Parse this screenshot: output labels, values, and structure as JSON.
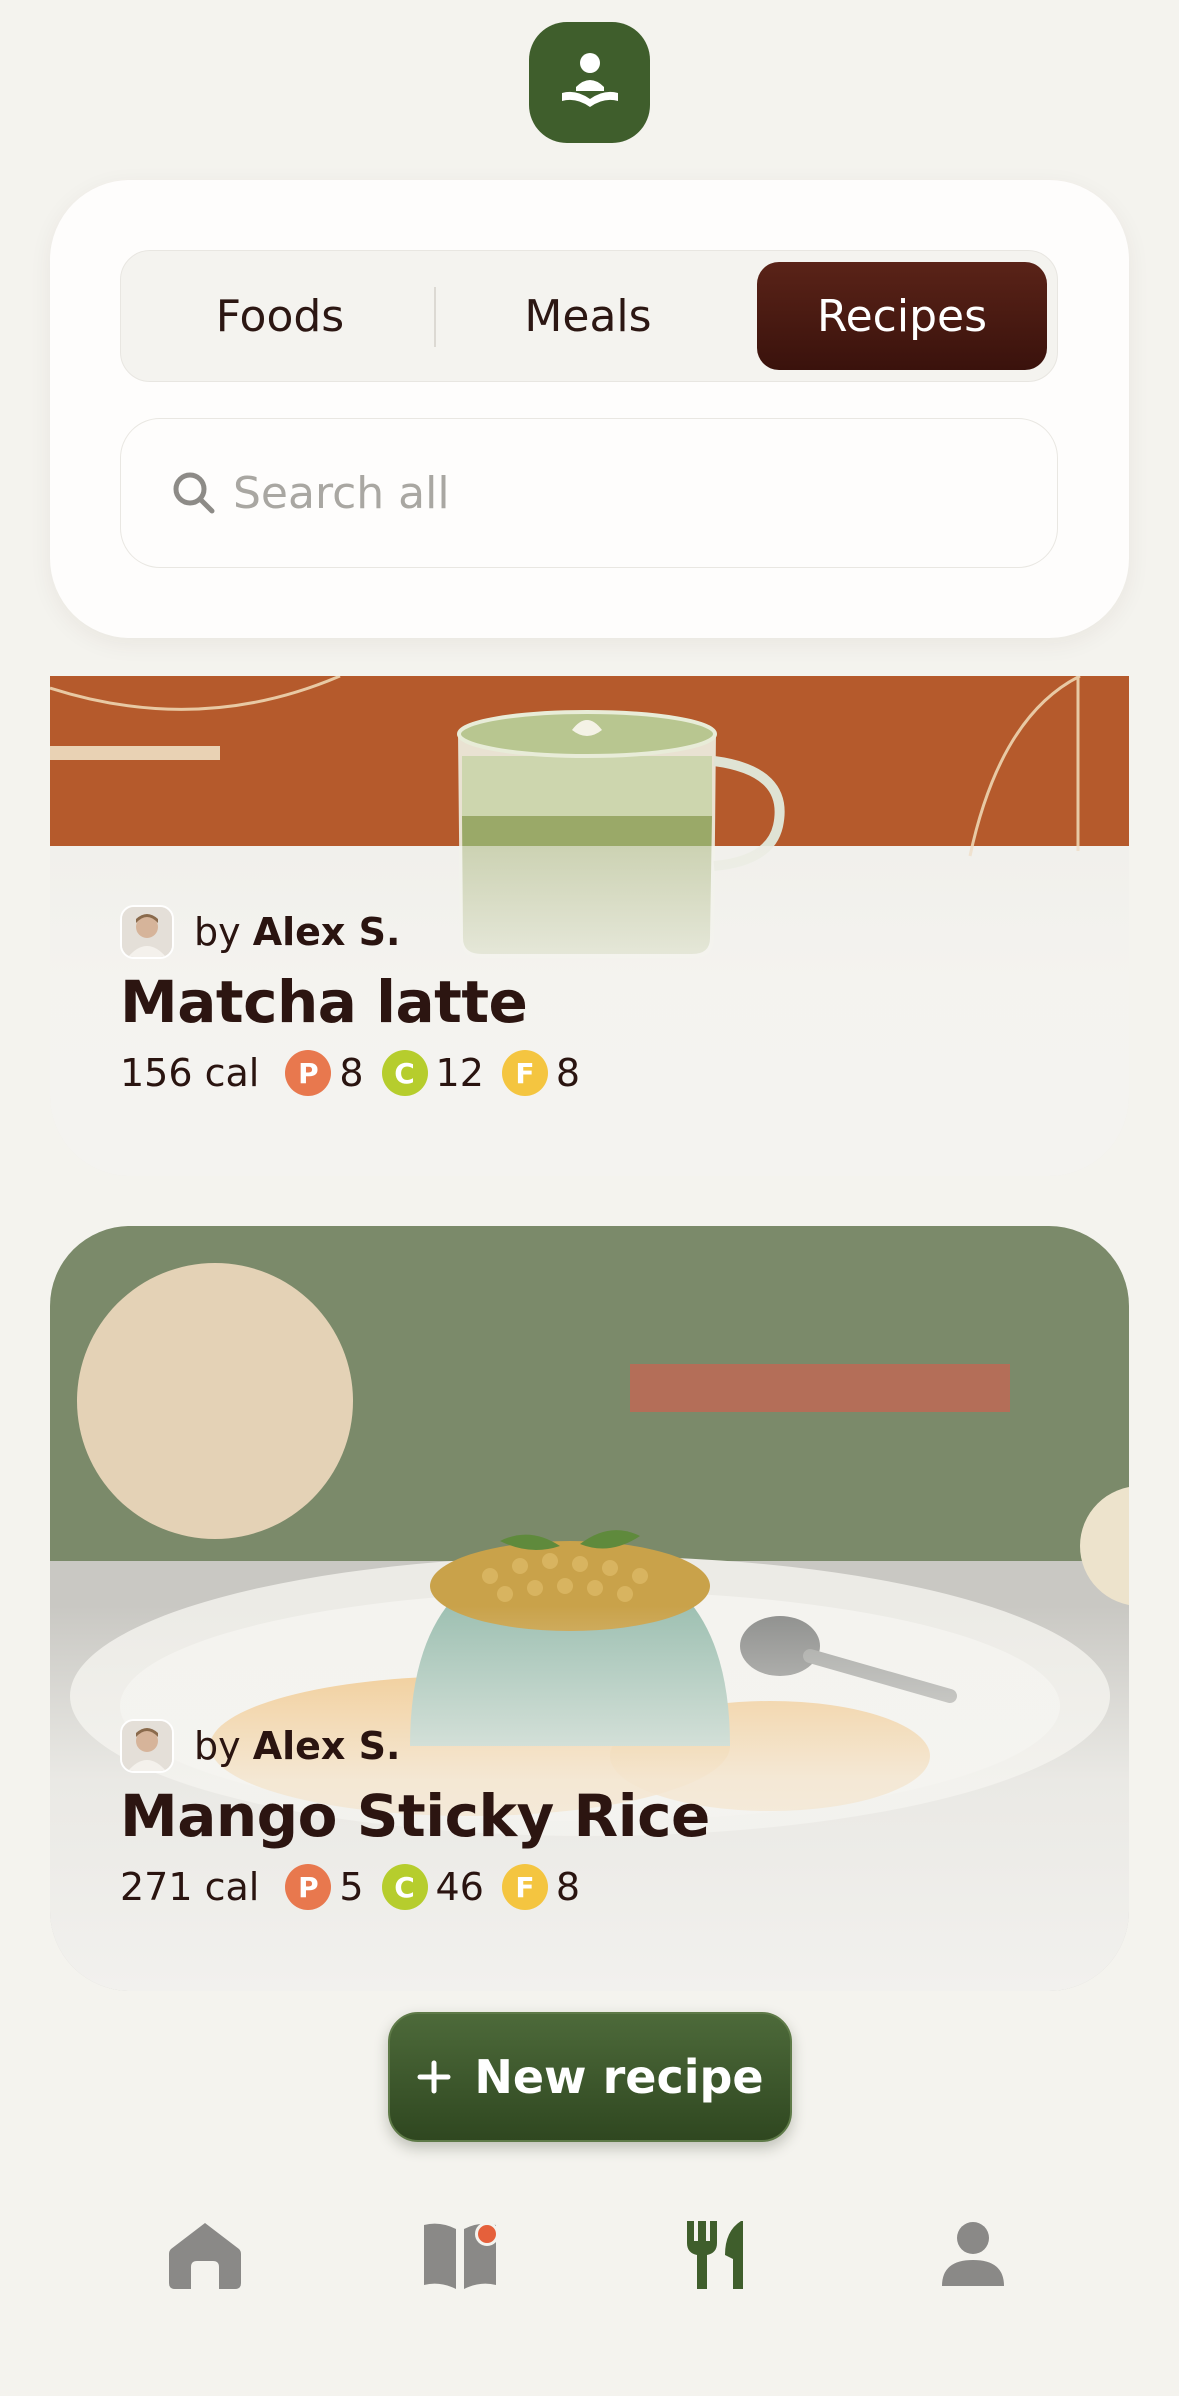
{
  "segments": {
    "items": [
      {
        "label": "Foods",
        "selected": false
      },
      {
        "label": "Meals",
        "selected": false
      },
      {
        "label": "Recipes",
        "selected": true
      }
    ]
  },
  "search": {
    "placeholder": "Search all",
    "value": ""
  },
  "recipes": [
    {
      "by": "by",
      "author": "Alex S.",
      "title": "Matcha latte",
      "calories": "156 cal",
      "protein_badge": "P",
      "protein": "8",
      "carbs_badge": "C",
      "carbs": "12",
      "fat_badge": "F",
      "fat": "8"
    },
    {
      "by": "by",
      "author": "Alex S.",
      "title": "Mango Sticky Rice",
      "calories": "271 cal",
      "protein_badge": "P",
      "protein": "5",
      "carbs_badge": "C",
      "carbs": "46",
      "fat_badge": "F",
      "fat": "8"
    }
  ],
  "new_recipe_label": "New recipe",
  "nav": {
    "items": [
      "home-icon",
      "journal-icon",
      "recipes-icon",
      "profile-icon"
    ],
    "active": "recipes-icon",
    "journal_has_notification": true
  },
  "colors": {
    "accent_green": "#3f5e2c",
    "selected_segment": "#4a1a12",
    "protein": "#e8784e",
    "carbs": "#b6cd2d",
    "fat": "#f4c540",
    "notification": "#e5603b"
  }
}
